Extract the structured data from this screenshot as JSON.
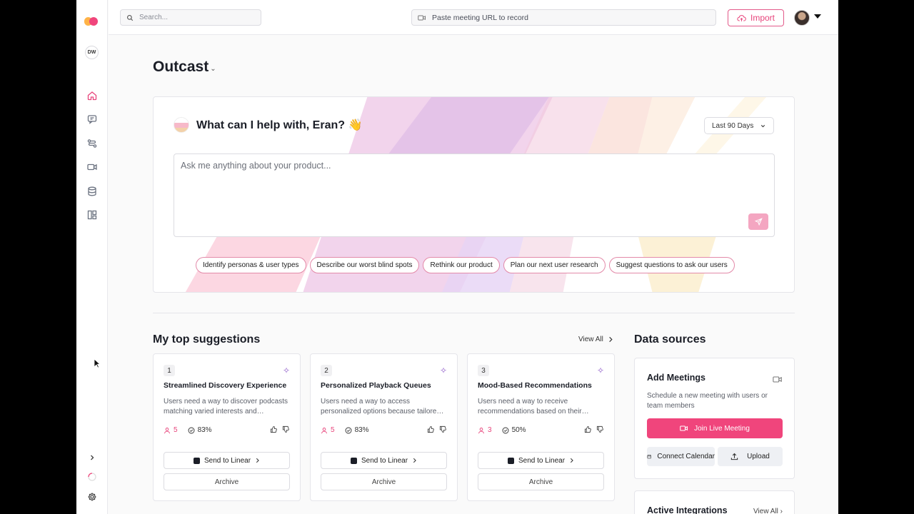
{
  "sidebar": {
    "workspace_initials": "DW",
    "nav": [
      "home-icon",
      "chat-icon",
      "workflow-icon",
      "video-icon",
      "database-icon",
      "board-icon"
    ],
    "bottom": [
      "chevron-right-icon",
      "loading-icon",
      "gear-icon"
    ]
  },
  "topbar": {
    "search_placeholder": "Search...",
    "meeting_url_placeholder": "Paste meeting URL to record",
    "import_label": "Import"
  },
  "page": {
    "title": "Outcast"
  },
  "hero": {
    "greeting": "What can I help with, Eran? 👋",
    "range_label": "Last 90 Days",
    "prompt_placeholder": "Ask me anything about your product...",
    "chips": [
      "Identify personas & user types",
      "Describe our worst blind spots",
      "Rethink our product",
      "Plan our next user research",
      "Suggest questions to ask our users"
    ]
  },
  "suggestions": {
    "title": "My top suggestions",
    "view_all": "View All",
    "items": [
      {
        "num": "1",
        "title": "Streamlined Discovery Experience",
        "desc": "Users need a way to discover podcasts matching varied interests and…",
        "users": "5",
        "pct": "83%"
      },
      {
        "num": "2",
        "title": "Personalized Playback Queues",
        "desc": "Users need a way to access personalized options because tailore…",
        "users": "5",
        "pct": "83%"
      },
      {
        "num": "3",
        "title": "Mood-Based Recommendations",
        "desc": "Users need a way to receive recommendations based on their…",
        "users": "3",
        "pct": "50%"
      }
    ],
    "send_label": "Send to Linear",
    "archive_label": "Archive"
  },
  "data_sources": {
    "title": "Data sources",
    "add_meetings": {
      "title": "Add Meetings",
      "desc": "Schedule a new meeting with users or team members",
      "join_label": "Join Live Meeting",
      "calendar_label": "Connect Calendar",
      "upload_label": "Upload"
    },
    "integrations": {
      "title": "Active Integrations",
      "view_all": "View All"
    }
  },
  "colors": {
    "accent": "#f0457c",
    "accent_text": "#e8457c"
  }
}
